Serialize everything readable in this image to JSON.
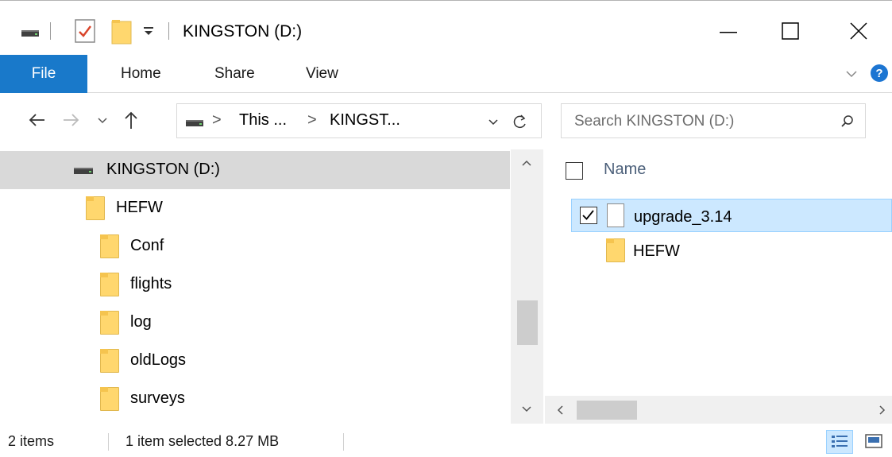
{
  "window": {
    "title": "KINGSTON (D:)",
    "quick_access_dropdown": "▾"
  },
  "ribbon": {
    "tabs": [
      {
        "label": "File"
      },
      {
        "label": "Home"
      },
      {
        "label": "Share"
      },
      {
        "label": "View"
      }
    ]
  },
  "address": {
    "segments": [
      "This ...",
      "KINGST..."
    ],
    "separator": ">"
  },
  "search": {
    "placeholder": "Search KINGSTON (D:)"
  },
  "nav_pane": {
    "items": [
      {
        "label": "KINGSTON (D:)",
        "icon": "drive-icon",
        "selected": true
      },
      {
        "label": "HEFW",
        "icon": "folder-icon"
      },
      {
        "label": "Conf",
        "icon": "folder-icon"
      },
      {
        "label": "flights",
        "icon": "folder-icon"
      },
      {
        "label": "log",
        "icon": "folder-icon"
      },
      {
        "label": "oldLogs",
        "icon": "folder-icon"
      },
      {
        "label": "surveys",
        "icon": "folder-icon"
      }
    ]
  },
  "content": {
    "column_header": "Name",
    "files": [
      {
        "name": "upgrade_3.14",
        "icon": "document-icon",
        "selected": true,
        "checked": true
      },
      {
        "name": "HEFW",
        "icon": "folder-icon",
        "selected": false
      }
    ]
  },
  "status": {
    "item_count": "2 items",
    "selection": "1 item selected  8.27 MB"
  },
  "colors": {
    "file_tab": "#1979ca",
    "selection_bg": "#cce8ff",
    "nav_selected_bg": "#d9d9d9",
    "folder": "#ffd76e",
    "help_icon": "#1c75d2"
  }
}
